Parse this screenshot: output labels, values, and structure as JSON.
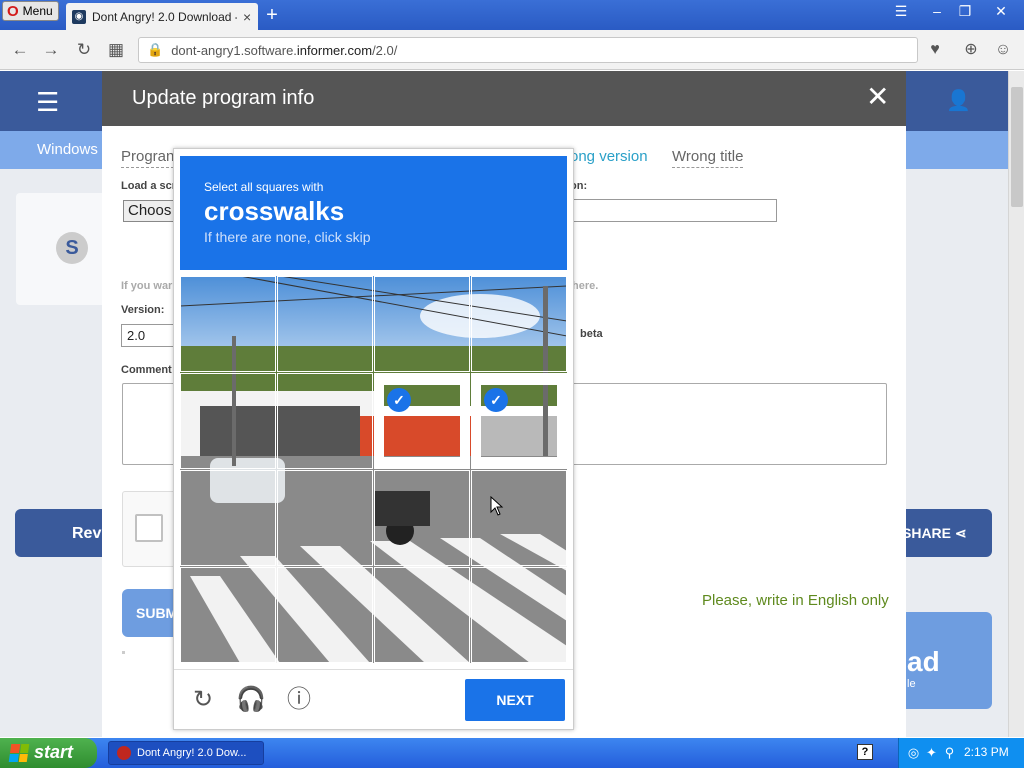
{
  "browser": {
    "menu_label": "Menu",
    "tab_title": "Dont Angry! 2.0 Download - I",
    "tab_close": "×",
    "new_tab": "+",
    "url_prefix": "dont-angry1.software.",
    "url_domain": "informer.com",
    "url_path": "/2.0/"
  },
  "site": {
    "subnav_label": "Windows",
    "review_button": "Rev",
    "share_button": "SHARE",
    "download_big": "ad",
    "download_small": "le"
  },
  "modal": {
    "title": "Update program info",
    "tabs": [
      "Progran",
      "ong version",
      "Wrong title"
    ],
    "load_label": "Load a scr",
    "choose_button": "Choos",
    "version_side_label": "on:",
    "hint_left": "If you war",
    "hint_right": "here.",
    "version_label": "Version:",
    "version_value": "2.0",
    "beta_label": "beta",
    "comment_label": "Comment",
    "submit_label": "SUBMIT",
    "english_note": "Please, write in English only"
  },
  "captcha": {
    "instruction_small": "Select all squares with",
    "instruction_big": "crosswalks",
    "instruction_hint": "If there are none, click skip",
    "next_button": "NEXT",
    "selected_cells": [
      6,
      7
    ],
    "icons": [
      "reload-icon",
      "audio-icon",
      "info-icon"
    ]
  },
  "taskbar": {
    "start_label": "start",
    "task_item": "Dont Angry! 2.0 Dow...",
    "clock": "2:13 PM"
  }
}
